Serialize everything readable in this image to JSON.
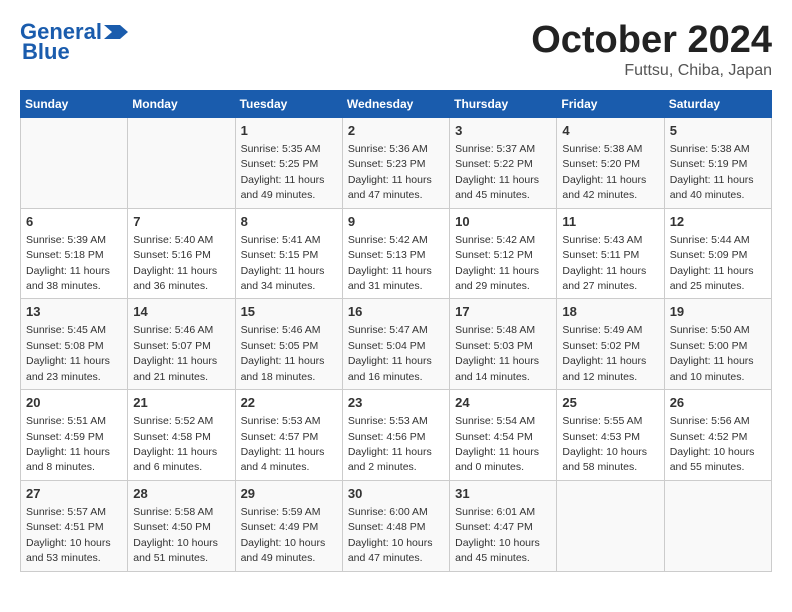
{
  "header": {
    "logo_general": "General",
    "logo_blue": "Blue",
    "month_title": "October 2024",
    "location": "Futtsu, Chiba, Japan"
  },
  "days_of_week": [
    "Sunday",
    "Monday",
    "Tuesday",
    "Wednesday",
    "Thursday",
    "Friday",
    "Saturday"
  ],
  "weeks": [
    [
      {
        "day": "",
        "info": ""
      },
      {
        "day": "",
        "info": ""
      },
      {
        "day": "1",
        "info": "Sunrise: 5:35 AM\nSunset: 5:25 PM\nDaylight: 11 hours and 49 minutes."
      },
      {
        "day": "2",
        "info": "Sunrise: 5:36 AM\nSunset: 5:23 PM\nDaylight: 11 hours and 47 minutes."
      },
      {
        "day": "3",
        "info": "Sunrise: 5:37 AM\nSunset: 5:22 PM\nDaylight: 11 hours and 45 minutes."
      },
      {
        "day": "4",
        "info": "Sunrise: 5:38 AM\nSunset: 5:20 PM\nDaylight: 11 hours and 42 minutes."
      },
      {
        "day": "5",
        "info": "Sunrise: 5:38 AM\nSunset: 5:19 PM\nDaylight: 11 hours and 40 minutes."
      }
    ],
    [
      {
        "day": "6",
        "info": "Sunrise: 5:39 AM\nSunset: 5:18 PM\nDaylight: 11 hours and 38 minutes."
      },
      {
        "day": "7",
        "info": "Sunrise: 5:40 AM\nSunset: 5:16 PM\nDaylight: 11 hours and 36 minutes."
      },
      {
        "day": "8",
        "info": "Sunrise: 5:41 AM\nSunset: 5:15 PM\nDaylight: 11 hours and 34 minutes."
      },
      {
        "day": "9",
        "info": "Sunrise: 5:42 AM\nSunset: 5:13 PM\nDaylight: 11 hours and 31 minutes."
      },
      {
        "day": "10",
        "info": "Sunrise: 5:42 AM\nSunset: 5:12 PM\nDaylight: 11 hours and 29 minutes."
      },
      {
        "day": "11",
        "info": "Sunrise: 5:43 AM\nSunset: 5:11 PM\nDaylight: 11 hours and 27 minutes."
      },
      {
        "day": "12",
        "info": "Sunrise: 5:44 AM\nSunset: 5:09 PM\nDaylight: 11 hours and 25 minutes."
      }
    ],
    [
      {
        "day": "13",
        "info": "Sunrise: 5:45 AM\nSunset: 5:08 PM\nDaylight: 11 hours and 23 minutes."
      },
      {
        "day": "14",
        "info": "Sunrise: 5:46 AM\nSunset: 5:07 PM\nDaylight: 11 hours and 21 minutes."
      },
      {
        "day": "15",
        "info": "Sunrise: 5:46 AM\nSunset: 5:05 PM\nDaylight: 11 hours and 18 minutes."
      },
      {
        "day": "16",
        "info": "Sunrise: 5:47 AM\nSunset: 5:04 PM\nDaylight: 11 hours and 16 minutes."
      },
      {
        "day": "17",
        "info": "Sunrise: 5:48 AM\nSunset: 5:03 PM\nDaylight: 11 hours and 14 minutes."
      },
      {
        "day": "18",
        "info": "Sunrise: 5:49 AM\nSunset: 5:02 PM\nDaylight: 11 hours and 12 minutes."
      },
      {
        "day": "19",
        "info": "Sunrise: 5:50 AM\nSunset: 5:00 PM\nDaylight: 11 hours and 10 minutes."
      }
    ],
    [
      {
        "day": "20",
        "info": "Sunrise: 5:51 AM\nSunset: 4:59 PM\nDaylight: 11 hours and 8 minutes."
      },
      {
        "day": "21",
        "info": "Sunrise: 5:52 AM\nSunset: 4:58 PM\nDaylight: 11 hours and 6 minutes."
      },
      {
        "day": "22",
        "info": "Sunrise: 5:53 AM\nSunset: 4:57 PM\nDaylight: 11 hours and 4 minutes."
      },
      {
        "day": "23",
        "info": "Sunrise: 5:53 AM\nSunset: 4:56 PM\nDaylight: 11 hours and 2 minutes."
      },
      {
        "day": "24",
        "info": "Sunrise: 5:54 AM\nSunset: 4:54 PM\nDaylight: 11 hours and 0 minutes."
      },
      {
        "day": "25",
        "info": "Sunrise: 5:55 AM\nSunset: 4:53 PM\nDaylight: 10 hours and 58 minutes."
      },
      {
        "day": "26",
        "info": "Sunrise: 5:56 AM\nSunset: 4:52 PM\nDaylight: 10 hours and 55 minutes."
      }
    ],
    [
      {
        "day": "27",
        "info": "Sunrise: 5:57 AM\nSunset: 4:51 PM\nDaylight: 10 hours and 53 minutes."
      },
      {
        "day": "28",
        "info": "Sunrise: 5:58 AM\nSunset: 4:50 PM\nDaylight: 10 hours and 51 minutes."
      },
      {
        "day": "29",
        "info": "Sunrise: 5:59 AM\nSunset: 4:49 PM\nDaylight: 10 hours and 49 minutes."
      },
      {
        "day": "30",
        "info": "Sunrise: 6:00 AM\nSunset: 4:48 PM\nDaylight: 10 hours and 47 minutes."
      },
      {
        "day": "31",
        "info": "Sunrise: 6:01 AM\nSunset: 4:47 PM\nDaylight: 10 hours and 45 minutes."
      },
      {
        "day": "",
        "info": ""
      },
      {
        "day": "",
        "info": ""
      }
    ]
  ]
}
